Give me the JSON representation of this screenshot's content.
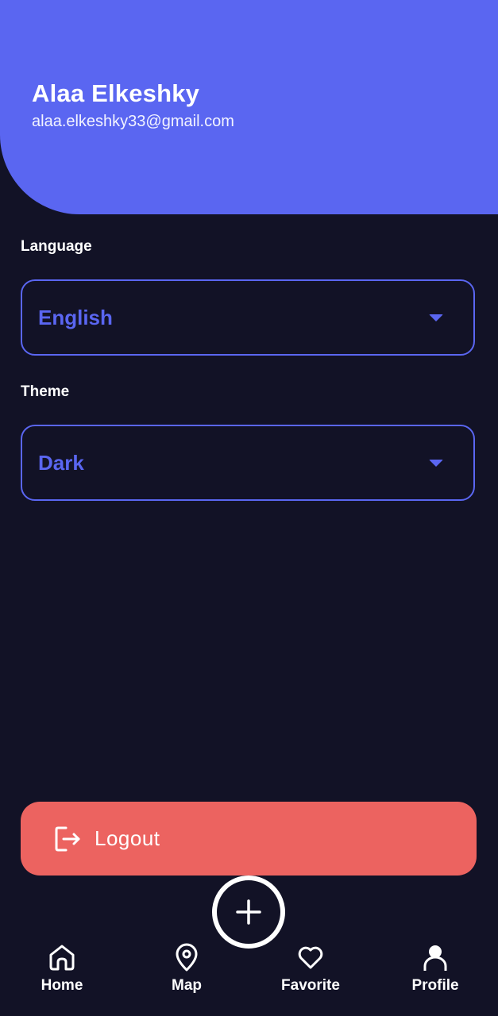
{
  "header": {
    "name": "Alaa Elkeshky",
    "email": "alaa.elkeshky33@gmail.com",
    "background_color": "#5a66f1"
  },
  "settings": {
    "language": {
      "label": "Language",
      "value": "English",
      "icon": "chevron-down-icon"
    },
    "theme": {
      "label": "Theme",
      "value": "Dark",
      "icon": "chevron-down-icon"
    },
    "accent_color": "#5a66f1"
  },
  "logout": {
    "label": "Logout",
    "icon": "logout-icon",
    "color": "#ec6360"
  },
  "fab": {
    "icon": "plus-icon"
  },
  "nav": {
    "items": [
      {
        "label": "Home",
        "icon": "home-icon"
      },
      {
        "label": "Map",
        "icon": "map-pin-icon"
      },
      {
        "label": "Favorite",
        "icon": "heart-icon"
      },
      {
        "label": "Profile",
        "icon": "person-icon"
      }
    ],
    "active": "Profile"
  },
  "page_background": "#121226"
}
